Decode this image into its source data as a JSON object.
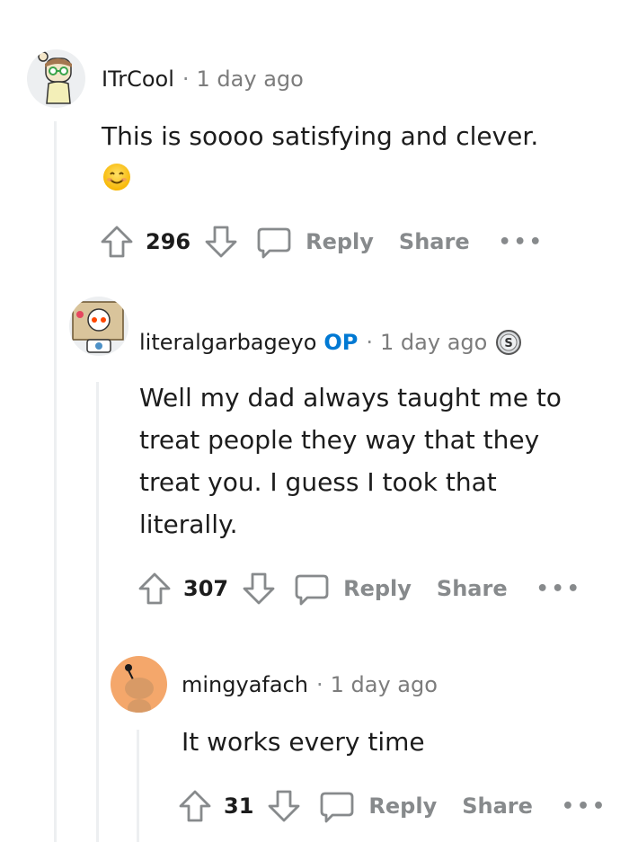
{
  "comments": [
    {
      "username": "ITrCool",
      "time": "1 day ago",
      "body": "This is soooo satisfying and clever.",
      "emoji": "smiling-face-emoji",
      "score": "296",
      "reply_label": "Reply",
      "share_label": "Share",
      "more_label": "•••"
    },
    {
      "username": "literalgarbageyo",
      "op_badge": "OP",
      "time": "1 day ago",
      "body": "Well my dad always taught me to\ntreat people they way that they\ntreat you. I guess I took that\nliterally.",
      "award_icon": "silver-award-icon",
      "score": "307",
      "reply_label": "Reply",
      "share_label": "Share",
      "more_label": "•••"
    },
    {
      "username": "mingyafach",
      "time": "1 day ago",
      "body": "It works every time",
      "score": "31",
      "reply_label": "Reply",
      "share_label": "Share",
      "more_label": "•••"
    }
  ],
  "separator": "·",
  "colors": {
    "op": "#0079d3",
    "meta_gray": "#7c7c7c",
    "action_gray": "#878a8c",
    "thread_line": "#edeff1",
    "avatar3_bg": "#f4a76b"
  }
}
